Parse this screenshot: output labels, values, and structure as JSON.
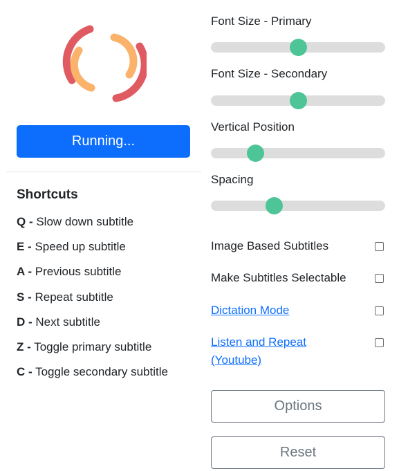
{
  "run_button": {
    "label": "Running...",
    "color": "#0d6efd"
  },
  "logo": {
    "icon": "spinner-arcs-icon",
    "outer_color": "#e05a62",
    "inner_color": "#fbb26a"
  },
  "shortcuts": {
    "title": "Shortcuts",
    "items": [
      {
        "key": "Q -",
        "desc": " Slow down subtitle"
      },
      {
        "key": "E -",
        "desc": " Speed up subtitle"
      },
      {
        "key": "A -",
        "desc": " Previous subtitle"
      },
      {
        "key": "S -",
        "desc": " Repeat subtitle"
      },
      {
        "key": "D -",
        "desc": " Next subtitle"
      },
      {
        "key": "Z -",
        "desc": " Toggle primary subtitle"
      },
      {
        "key": "C -",
        "desc": " Toggle secondary subtitle"
      }
    ]
  },
  "sliders": [
    {
      "label": "Font Size - Primary",
      "value": 0.5
    },
    {
      "label": "Font Size - Secondary",
      "value": 0.5
    },
    {
      "label": "Vertical Position",
      "value": 0.23
    },
    {
      "label": "Spacing",
      "value": 0.35
    }
  ],
  "slider_colors": {
    "track": "#dddddd",
    "thumb": "#4dc596"
  },
  "checkboxes": [
    {
      "label": "Image Based Subtitles",
      "checked": false,
      "link": false
    },
    {
      "label": "Make Subtitles Selectable",
      "checked": false,
      "link": false
    },
    {
      "label": "Dictation Mode",
      "checked": false,
      "link": true
    },
    {
      "label_line1": "Listen and Repeat",
      "label_line2": "(Youtube)",
      "checked": false,
      "link": true
    }
  ],
  "buttons": {
    "options_label": "Options",
    "reset_label": "Reset"
  }
}
